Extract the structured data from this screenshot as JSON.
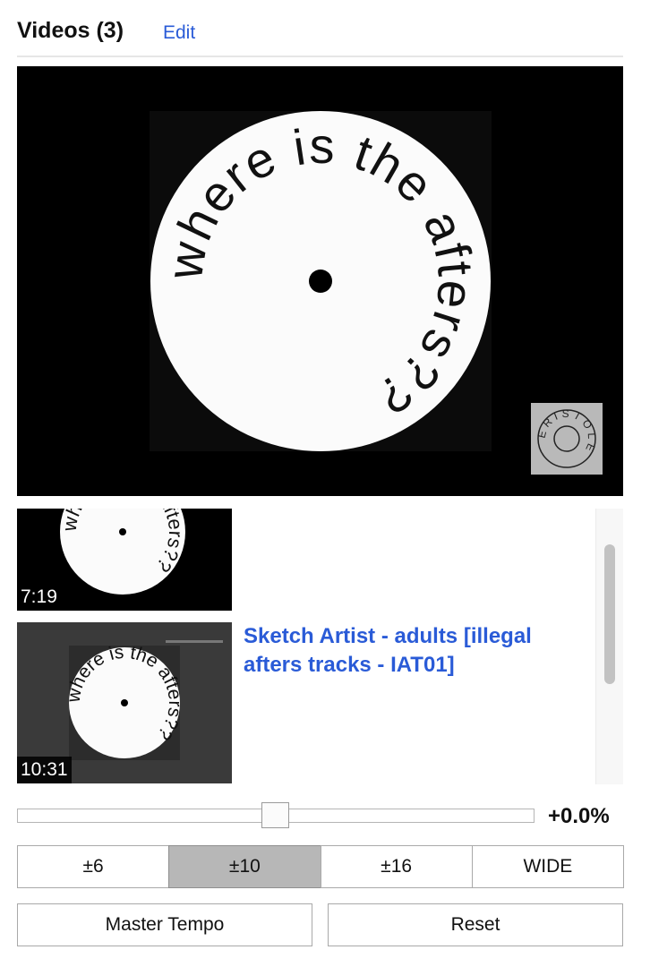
{
  "header": {
    "title": "Videos (3)",
    "edit_label": "Edit"
  },
  "player": {
    "disc_text": "where is the afters??",
    "logo_text": "ERISTOLE"
  },
  "videos": [
    {
      "duration": "7:19",
      "title": ""
    },
    {
      "duration": "10:31",
      "title": "Sketch Artist - adults [illegal afters tracks - IAT01]"
    }
  ],
  "tempo": {
    "value": "+0.0%",
    "level": 0.5,
    "ranges": [
      {
        "label": "±6",
        "active": false
      },
      {
        "label": "±10",
        "active": true
      },
      {
        "label": "±16",
        "active": false
      },
      {
        "label": "WIDE",
        "active": false
      }
    ],
    "master_tempo_label": "Master Tempo",
    "reset_label": "Reset"
  }
}
